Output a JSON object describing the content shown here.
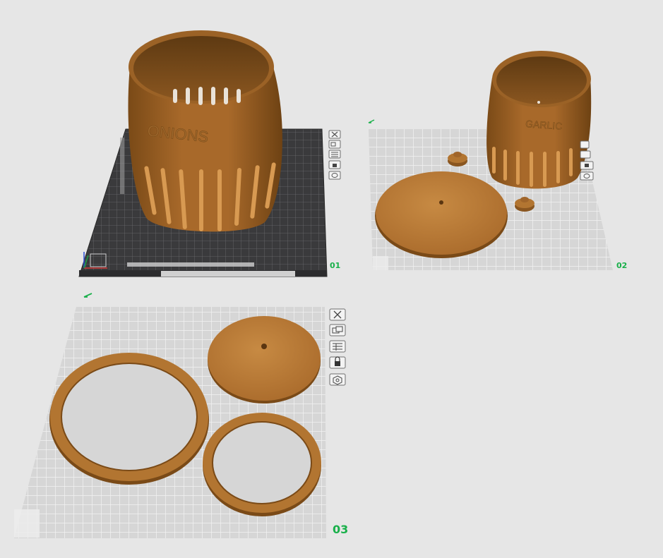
{
  "plates": [
    {
      "id": "plate-1",
      "number": "01",
      "model_text": "ONIONS"
    },
    {
      "id": "plate-2",
      "number": "02",
      "model_text": "GARLIC"
    },
    {
      "id": "plate-3",
      "number": "03"
    }
  ],
  "plate_tools": [
    {
      "name": "close-plate-icon"
    },
    {
      "name": "arrange-plate-icon"
    },
    {
      "name": "plate-settings-icon"
    },
    {
      "name": "lock-plate-icon"
    },
    {
      "name": "slice-plate-icon"
    }
  ],
  "colors": {
    "background": "#e6e6e6",
    "plate_grid": "#d8d8d8",
    "textured_plate": "#3c3c3e",
    "filament": "#b27531",
    "filament_dark": "#7a4a17",
    "plate_number": "#19b04a",
    "edit_icon": "#19b04a"
  }
}
